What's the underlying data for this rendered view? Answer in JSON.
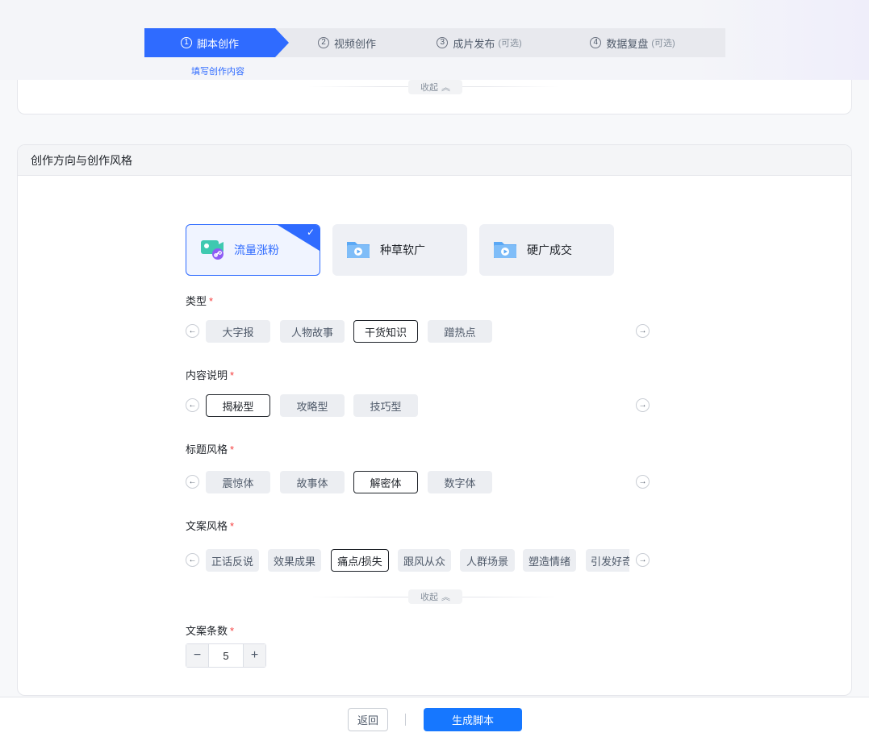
{
  "steps": [
    {
      "num": "1",
      "label": "脚本创作",
      "optional": ""
    },
    {
      "num": "2",
      "label": "视频创作",
      "optional": ""
    },
    {
      "num": "3",
      "label": "成片发布",
      "optional": "(可选)"
    },
    {
      "num": "4",
      "label": "数据复盘",
      "optional": "(可选)"
    }
  ],
  "step_sub": "填写创作内容",
  "collapse_label": "收起",
  "section_title": "创作方向与创作风格",
  "directions": [
    {
      "label": "流量涨粉",
      "icon": "video-link-icon"
    },
    {
      "label": "种草软广",
      "icon": "folder-play-icon"
    },
    {
      "label": "硬广成交",
      "icon": "folder-play-icon"
    }
  ],
  "fields": {
    "type": {
      "label": "类型",
      "options": [
        "大字报",
        "人物故事",
        "干货知识",
        "蹭热点"
      ],
      "selected": "干货知识"
    },
    "content": {
      "label": "内容说明",
      "options": [
        "揭秘型",
        "攻略型",
        "技巧型"
      ],
      "selected": "揭秘型"
    },
    "title_style": {
      "label": "标题风格",
      "options": [
        "震惊体",
        "故事体",
        "解密体",
        "数字体"
      ],
      "selected": "解密体"
    },
    "copy_style": {
      "label": "文案风格",
      "options": [
        "正话反说",
        "效果成果",
        "痛点/损失",
        "跟风从众",
        "人群场景",
        "塑造情绪",
        "引发好奇"
      ],
      "selected": "痛点/损失"
    },
    "copy_count": {
      "label": "文案条数",
      "value": "5"
    }
  },
  "required_mark": "*",
  "footer": {
    "back_label": "返回",
    "generate_label": "生成脚本"
  },
  "colors": {
    "primary": "#2f6bff",
    "button": "#1677ff",
    "required": "#f53f3f"
  }
}
